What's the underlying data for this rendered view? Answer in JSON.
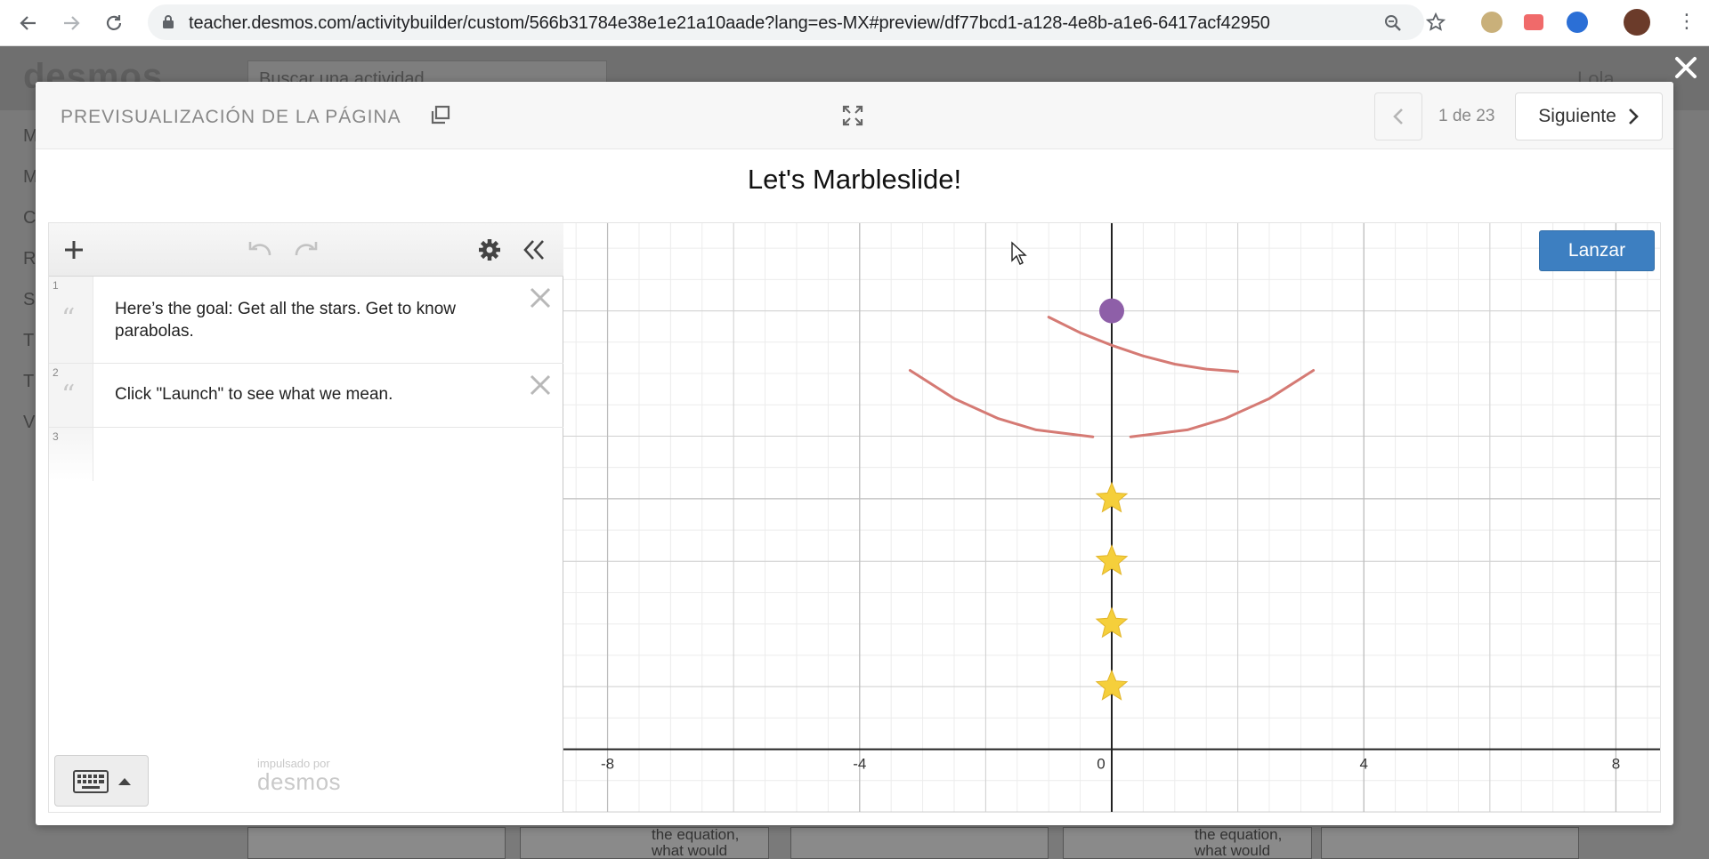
{
  "browser": {
    "url": "teacher.desmos.com/activitybuilder/custom/566b31784e38e1e21a10aade?lang=es-MX#preview/df77bcd1-a128-4e8b-a1e6-6417acf42950",
    "back_icon": "arrow-left-icon",
    "forward_icon": "arrow-right-icon",
    "reload_icon": "reload-icon"
  },
  "background_page": {
    "logo": "desmos",
    "search_placeholder": "Buscar una actividad",
    "user": "Lola",
    "sidebar_letters": [
      "M",
      "M",
      "C",
      "R",
      "S",
      "T",
      "T",
      "V"
    ],
    "thumb_texts": [
      "the equation,\nwhat would",
      "the equation,\nwhat would"
    ]
  },
  "modal": {
    "header": {
      "preview_label": "PREVISUALIZACIÓN DE LA PÁGINA",
      "page_count": "1 de 23",
      "next_label": "Siguiente"
    },
    "title": "Let's Marbleslide!",
    "expressions": [
      {
        "num": "1",
        "text": "Here’s the goal: Get all the stars. Get to know parabolas."
      },
      {
        "num": "2",
        "text": "Click \"Launch\" to see what we mean."
      },
      {
        "num": "3",
        "text": ""
      }
    ],
    "powered_by": "impulsado por",
    "powered_logo": "desmos",
    "launch_label": "Lanzar"
  },
  "chart_data": {
    "type": "scatter",
    "title": "",
    "xlabel": "",
    "ylabel": "",
    "xlim": [
      -8.7,
      8.7
    ],
    "ylim": [
      -1,
      8.4
    ],
    "x_ticks": [
      -8,
      -4,
      0,
      4,
      8
    ],
    "x_tick_labels": [
      "-8",
      "-4",
      "0",
      "4",
      "8"
    ],
    "grid": true,
    "marble": {
      "x": 0,
      "y": 7,
      "color": "#8e5fa8"
    },
    "stars": [
      {
        "x": 0,
        "y": 4,
        "color": "#f5cf3b"
      },
      {
        "x": 0,
        "y": 3,
        "color": "#f5cf3b"
      },
      {
        "x": 0,
        "y": 2,
        "color": "#f5cf3b"
      },
      {
        "x": 0,
        "y": 1,
        "color": "#f5cf3b"
      }
    ],
    "curves": [
      {
        "name": "parabola-upper",
        "color": "#d57a74",
        "x_from": -1,
        "x_to": 2,
        "points": [
          [
            -1,
            6.9
          ],
          [
            -0.5,
            6.65
          ],
          [
            0,
            6.45
          ],
          [
            0.5,
            6.28
          ],
          [
            1,
            6.15
          ],
          [
            1.5,
            6.07
          ],
          [
            2,
            6.03
          ]
        ]
      },
      {
        "name": "parabola-lower-left",
        "color": "#d57a74",
        "x_from": -3.2,
        "x_to": -0.3,
        "points": [
          [
            -3.2,
            6.05
          ],
          [
            -2.5,
            5.6
          ],
          [
            -1.8,
            5.28
          ],
          [
            -1.2,
            5.1
          ],
          [
            -0.3,
            4.99
          ]
        ]
      },
      {
        "name": "parabola-lower-right",
        "color": "#d57a74",
        "x_from": 0.3,
        "x_to": 3.2,
        "points": [
          [
            0.3,
            4.99
          ],
          [
            1.2,
            5.1
          ],
          [
            1.8,
            5.28
          ],
          [
            2.5,
            5.6
          ],
          [
            3.2,
            6.05
          ]
        ]
      }
    ]
  },
  "colors": {
    "launch_button": "#3d7fc1",
    "marble": "#8e5fa8",
    "star": "#f5cf3b",
    "curve": "#d57a74"
  }
}
